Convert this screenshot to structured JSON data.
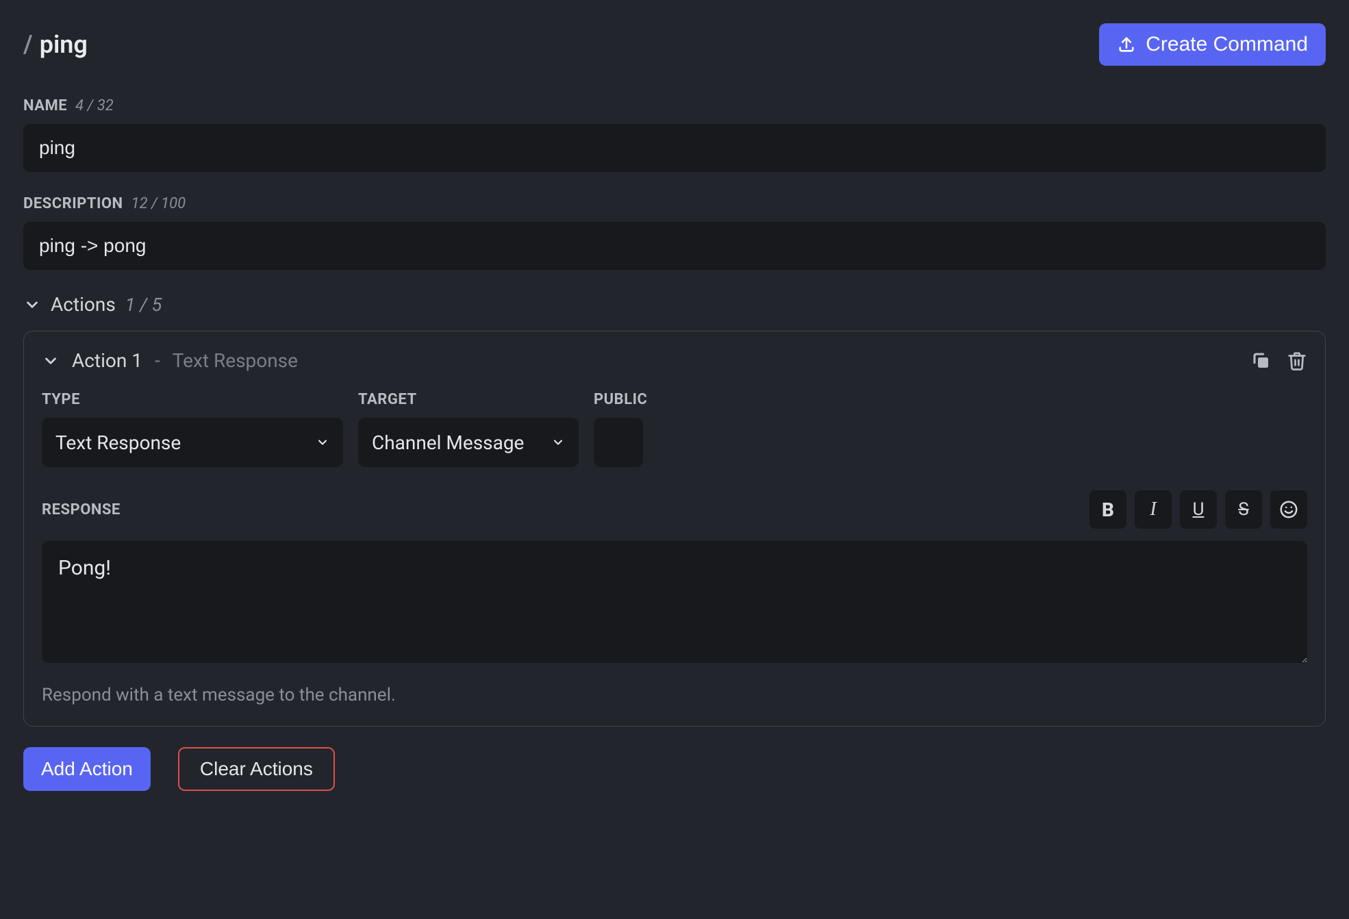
{
  "header": {
    "slash": "/",
    "command_name": "ping",
    "create_label": "Create Command"
  },
  "name_field": {
    "label": "NAME",
    "counter": "4 / 32",
    "value": "ping"
  },
  "description_field": {
    "label": "DESCRIPTION",
    "counter": "12 / 100",
    "value": "ping -> pong"
  },
  "actions_section": {
    "title": "Actions",
    "counter": "1 / 5"
  },
  "action": {
    "title": "Action 1",
    "dash": "-",
    "subtitle": "Text Response",
    "type": {
      "label": "TYPE",
      "selected": "Text Response"
    },
    "target": {
      "label": "TARGET",
      "selected": "Channel Message"
    },
    "public": {
      "label": "PUBLIC"
    },
    "response": {
      "label": "RESPONSE",
      "value": "Pong!"
    },
    "help": "Respond with a text message to the channel."
  },
  "buttons": {
    "add_action": "Add Action",
    "clear_actions": "Clear Actions"
  },
  "toolbar": {
    "bold": "B",
    "italic": "I",
    "underline": "U",
    "strike": "S"
  }
}
